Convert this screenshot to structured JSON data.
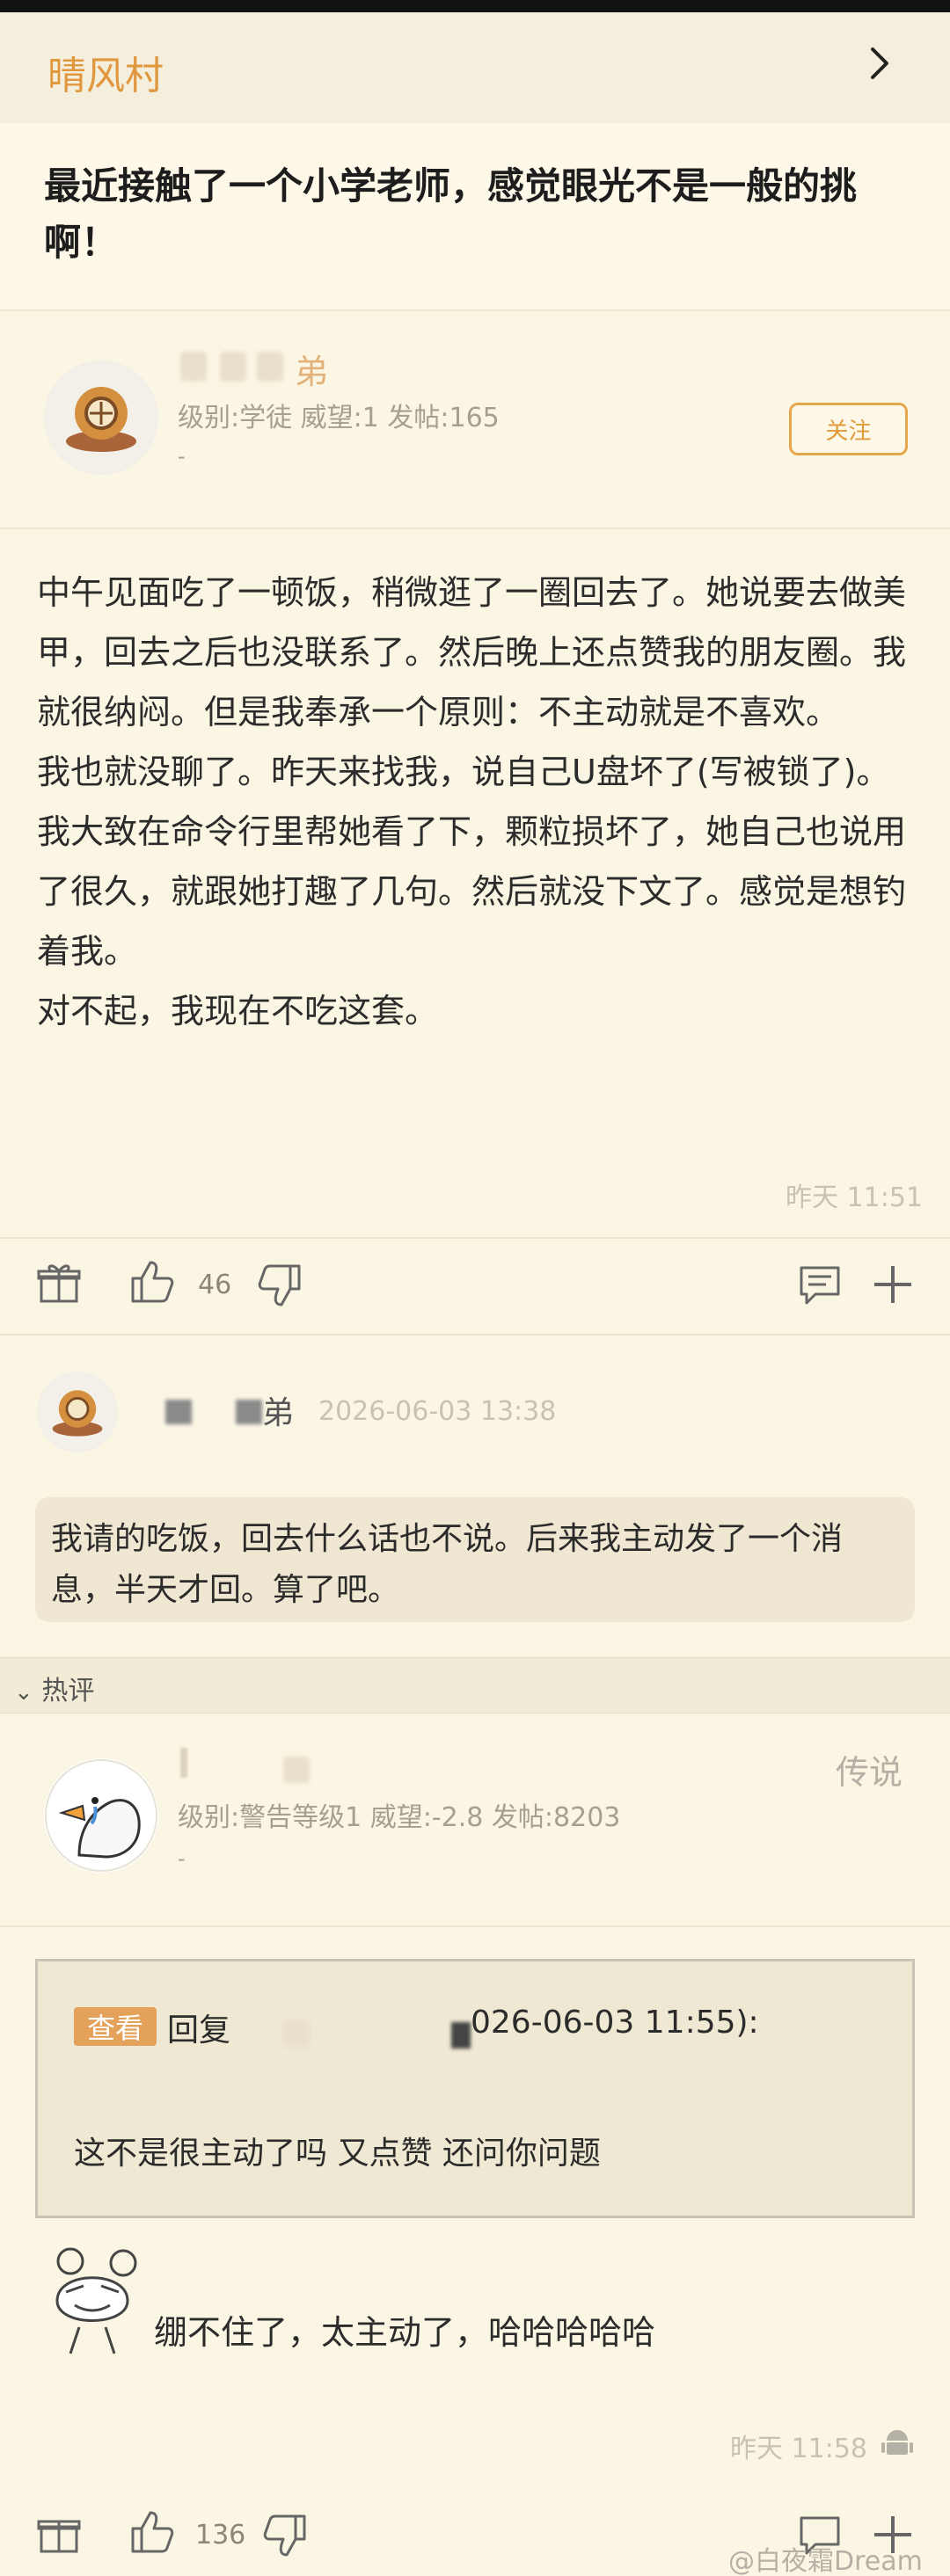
{
  "forum": {
    "name": "晴风村"
  },
  "post": {
    "title": "最近接触了一个小学老师，感觉眼光不是一般的挑啊！",
    "author": {
      "name_suffix": "弟",
      "meta": "级别:学徒 威望:1 发帖:165",
      "dash": "-"
    },
    "follow_label": "关注",
    "body": "中午见面吃了一顿饭，稍微逛了一圈回去了。她说要去做美甲，回去之后也没联系了。然后晚上还点赞我的朋友圈。我就很纳闷。但是我奉承一个原则：不主动就是不喜欢。\n我也就没聊了。昨天来找我，说自己U盘坏了(写被锁了)。我大致在命令行里帮她看了下，颗粒损坏了，她自己也说用了很久，就跟她打趣了几句。然后就没下文了。感觉是想钓着我。\n对不起，我现在不吃这套。",
    "time": "昨天 11:51",
    "likes": "46"
  },
  "author_reply": {
    "name_suffix": "弟",
    "time": "2026-06-03 13:38",
    "text": "我请的吃饭，回去什么话也不说。后来我主动发了一个消息，半天才回。算了吧。"
  },
  "hot": {
    "label": "热评"
  },
  "hot_comment": {
    "meta": "级别:警告等级1 威望:-2.8 发帖:8203",
    "dash": "-",
    "rank": "传说",
    "quote_badge": "查看",
    "quote_prefix": "回复",
    "quote_date": "026-06-03 11:55):",
    "quote_text": "这不是很主动了吗 又点赞 还问你问题",
    "text": "绷不住了，太主动了，哈哈哈哈哈",
    "time": "昨天 11:58",
    "likes": "136"
  },
  "watermark": "@白夜霜Dream",
  "colors": {
    "accent": "#e0973d",
    "background": "#fbf6e4",
    "bubble": "#efe7d1"
  }
}
